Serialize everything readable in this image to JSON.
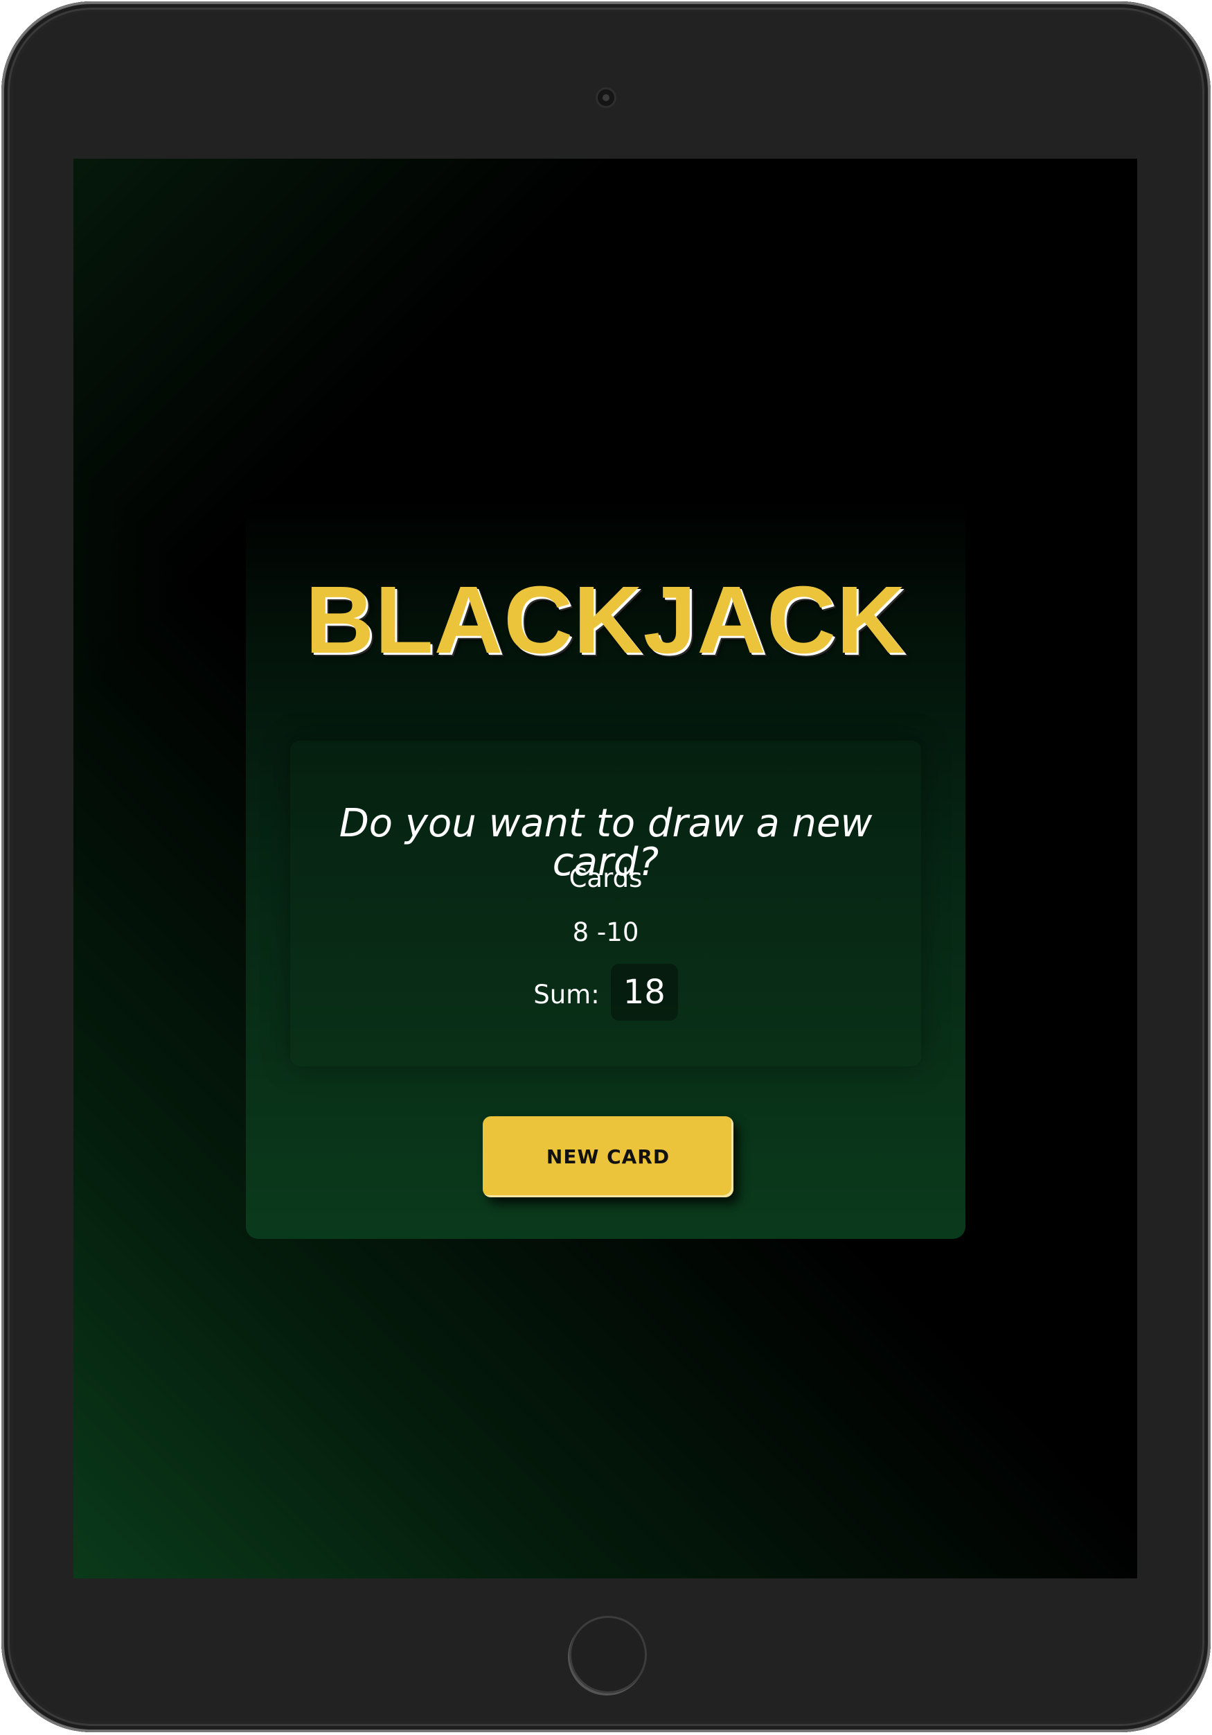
{
  "game": {
    "title": "BLACKJACK",
    "message": "Do you want to draw a new card?",
    "cards_label": "Cards",
    "cards_value": "8 -10",
    "sum_label": "Sum:",
    "sum_value": "18",
    "new_card_button": "NEW CARD"
  },
  "colors": {
    "accent": "#ecc43c",
    "panel_dark": "#000000",
    "panel_green": "#0a3a1c",
    "device_frame": "#222222"
  },
  "icons": {
    "camera": "camera-icon",
    "home_button": "home-button-icon"
  }
}
